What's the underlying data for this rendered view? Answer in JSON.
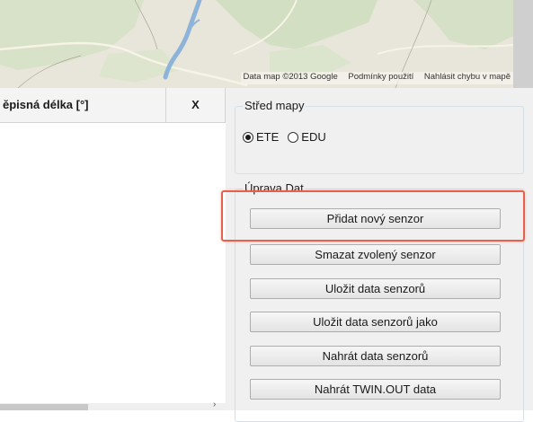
{
  "map": {
    "attribution": "Data map ©2013 Google",
    "terms_link": "Podmínky použití",
    "report_link": "Nahlásit chybu v mapě"
  },
  "grid": {
    "columns": [
      "ěpisná délka [°]",
      "X"
    ]
  },
  "map_center": {
    "title": "Střed mapy",
    "options": [
      {
        "label": "ETE",
        "checked": true
      },
      {
        "label": "EDU",
        "checked": false
      }
    ]
  },
  "data_edit": {
    "title": "Úprava Dat",
    "buttons": {
      "add_sensor": "Přidat nový senzor",
      "delete_sensor": "Smazat zvolený senzor",
      "save_sensors": "Uložit data senzorů",
      "save_sensors_as": "Uložit data senzorů jako",
      "load_sensors": "Nahrát data senzorů",
      "load_twin_out": "Nahrát TWIN.OUT data"
    }
  },
  "colors": {
    "highlight": "#e8604c",
    "panel_background": "#f0f0f0",
    "map_background": "#e9e6dc"
  }
}
